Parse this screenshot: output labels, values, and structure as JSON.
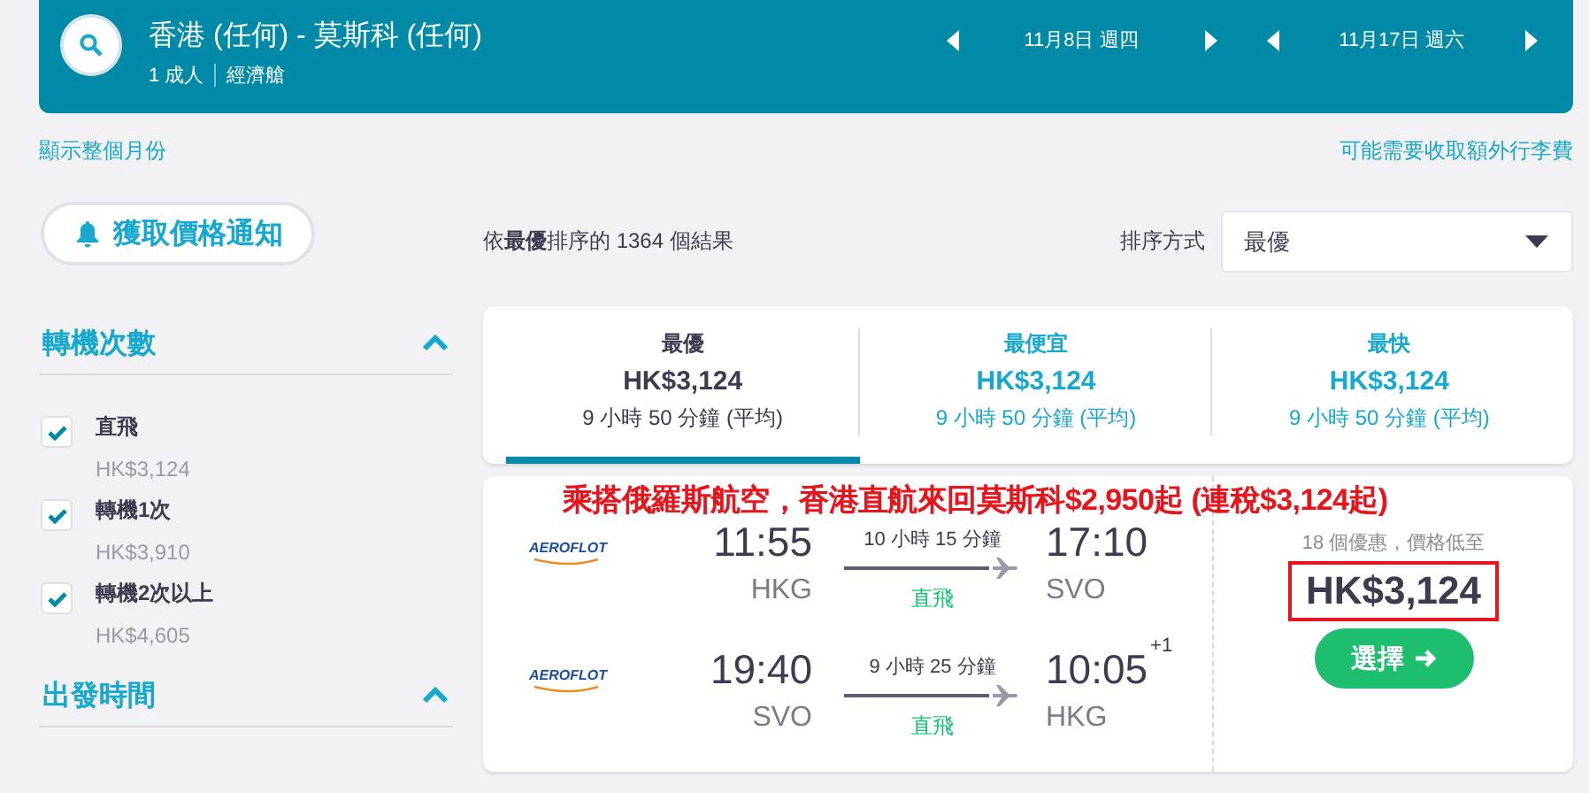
{
  "search": {
    "route": "香港 (任何) - 莫斯科 (任何)",
    "passengers": "1 成人",
    "cabin": "經濟艙"
  },
  "dates": [
    {
      "label": "11月8日 週四"
    },
    {
      "label": "11月17日 週六"
    }
  ],
  "links": {
    "left": "顯示整個月份",
    "right": "可能需要收取額外行李費"
  },
  "price_alert": "獲取價格通知",
  "filters": [
    {
      "title": "轉機次數",
      "expanded": true,
      "options": [
        {
          "label": "直飛",
          "price": "HK$3,124",
          "checked": true
        },
        {
          "label": "轉機1次",
          "price": "HK$3,910",
          "checked": true
        },
        {
          "label": "轉機2次以上",
          "price": "HK$4,605",
          "checked": true
        }
      ]
    },
    {
      "title": "出發時間",
      "expanded": true
    }
  ],
  "results_summary": "依**最優**排序的 1364 個結果",
  "sort": {
    "label": "排序方式",
    "value": "最優"
  },
  "tabs": [
    {
      "label": "最優",
      "price": "HK$3,124",
      "duration": "9 小時 50 分鐘 (平均)",
      "selected": true
    },
    {
      "label": "最便宜",
      "price": "HK$3,124",
      "duration": "9 小時 50 分鐘 (平均)",
      "selected": false
    },
    {
      "label": "最快",
      "price": "HK$3,124",
      "duration": "9 小時 50 分鐘 (平均)",
      "selected": false
    }
  ],
  "annotation": "乘搭俄羅斯航空，香港直航來回莫斯科$2,950起 (連稅$3,124起)",
  "flight": {
    "legs": [
      {
        "airline": "AEROFLOT",
        "depart_time": "11:55",
        "depart_airport": "HKG",
        "duration": "10 小時 15 分鐘",
        "stops": "直飛",
        "arrive_time": "17:10",
        "arrive_airport": "SVO"
      },
      {
        "airline": "AEROFLOT",
        "depart_time": "19:40",
        "depart_airport": "SVO",
        "duration": "9 小時 25 分鐘",
        "stops": "直飛",
        "arrive_time": "10:05",
        "arrive_airport": "HKG",
        "day_offset": "+1"
      }
    ],
    "deals": "18 個優惠，價格低至",
    "price": "HK$3,124",
    "select": "選擇"
  }
}
